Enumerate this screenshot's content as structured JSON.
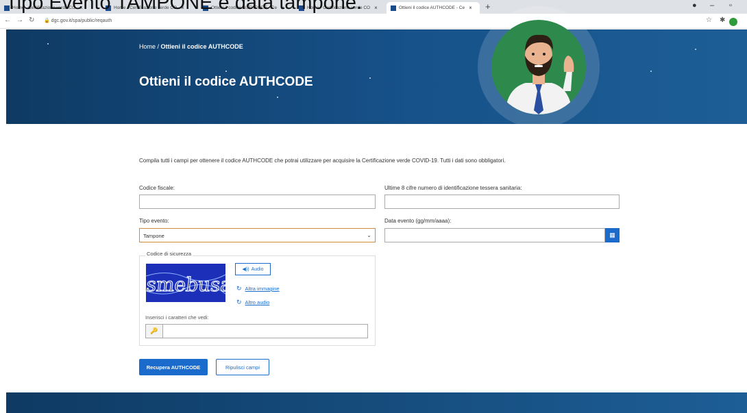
{
  "caption": "Tipo Evento TAMPONE e data tampone.",
  "browser": {
    "tabs": [
      {
        "label": "Home - Certificazione verde CO"
      },
      {
        "label": "Home - Certificazione verde CO"
      },
      {
        "label": "Ottieni il codice AUTHCODE - Ce"
      },
      {
        "label": "Home - Certificazione verde CO"
      },
      {
        "label": "Ottieni il codice AUTHCODE - Ce"
      }
    ],
    "url": "dgc.gov.it/spa/public/reqauth"
  },
  "hero": {
    "breadcrumb_home": "Home",
    "breadcrumb_sep": " / ",
    "breadcrumb_current": "Ottieni il codice AUTHCODE",
    "title": "Ottieni il codice AUTHCODE"
  },
  "form": {
    "intro": "Compila tutti i campi per ottenere il codice AUTHCODE che potrai utilizzare per acquisire la Certificazione verde COVID-19. Tutti i dati sono obbligatori.",
    "codice_fiscale_label": "Codice fiscale:",
    "tessera_label": "Ultime 8 cifre numero di identificazione tessera sanitaria:",
    "tipo_evento_label": "Tipo evento:",
    "tipo_evento_value": "Tampone",
    "data_evento_label": "Data evento (gg/mm/aaaa):",
    "captcha_legend": "Codice di sicurezza",
    "captcha_text": "smebusai",
    "audio_label": "Audio",
    "altra_immagine": "Altra immagine",
    "altro_audio": "Altro audio",
    "captcha_input_label": "Inserisci i caratteri che vedi:",
    "submit_label": "Recupera AUTHCODE",
    "reset_label": "Ripulisci campi"
  },
  "colors": {
    "primary": "#1a6bcc",
    "hero": "#17528a",
    "avatar_bg": "#2e8a4c"
  }
}
